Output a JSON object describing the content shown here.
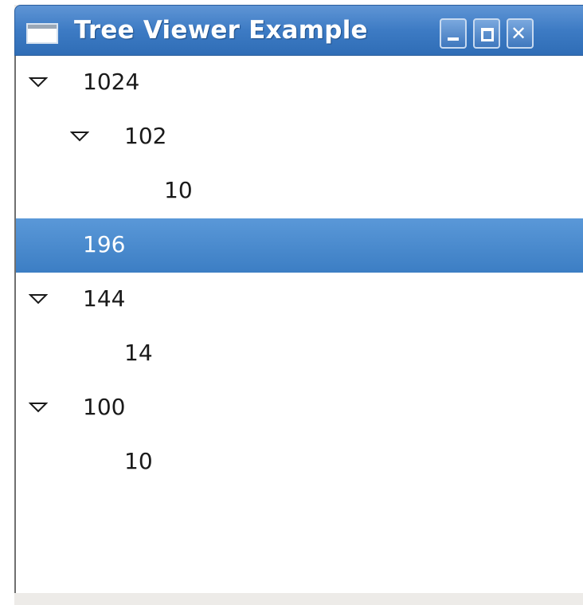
{
  "window": {
    "title": "Tree Viewer Example",
    "buttons": {
      "minimize": "minimize-icon",
      "maximize": "maximize-icon",
      "close": "close-icon"
    },
    "colors": {
      "titlebar": "#3d7bc4",
      "selection": "#4a8bcf"
    }
  },
  "tree": {
    "rows": [
      {
        "label": "1024",
        "expanded": true,
        "selected": false
      },
      {
        "label": "102",
        "expanded": true,
        "selected": false
      },
      {
        "label": "10",
        "expanded": false,
        "selected": false
      },
      {
        "label": "196",
        "expanded": false,
        "selected": true
      },
      {
        "label": "144",
        "expanded": true,
        "selected": false
      },
      {
        "label": "14",
        "expanded": false,
        "selected": false
      },
      {
        "label": "100",
        "expanded": true,
        "selected": false
      },
      {
        "label": "10",
        "expanded": false,
        "selected": false
      }
    ]
  }
}
